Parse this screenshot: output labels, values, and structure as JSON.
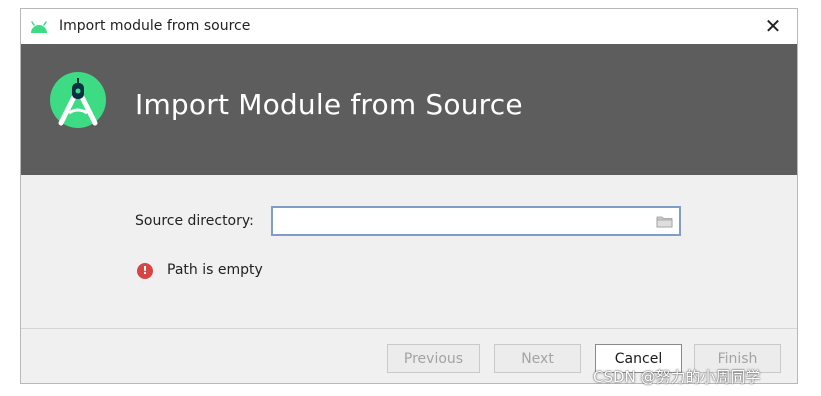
{
  "window": {
    "title": "Import module from source",
    "close_glyph": "✕"
  },
  "banner": {
    "title": "Import Module from Source",
    "logo": "android-studio-logo",
    "background": "#5d5d5d"
  },
  "form": {
    "source_label": "Source directory:",
    "source_value": "",
    "source_placeholder": "",
    "browse_icon": "folder-icon"
  },
  "validation": {
    "icon": "error-icon",
    "icon_glyph": "!",
    "message": "Path is empty",
    "color": "#d64545"
  },
  "buttons": {
    "previous": "Previous",
    "next": "Next",
    "cancel": "Cancel",
    "finish": "Finish"
  },
  "watermark": "CSDN @努力的小周同学"
}
